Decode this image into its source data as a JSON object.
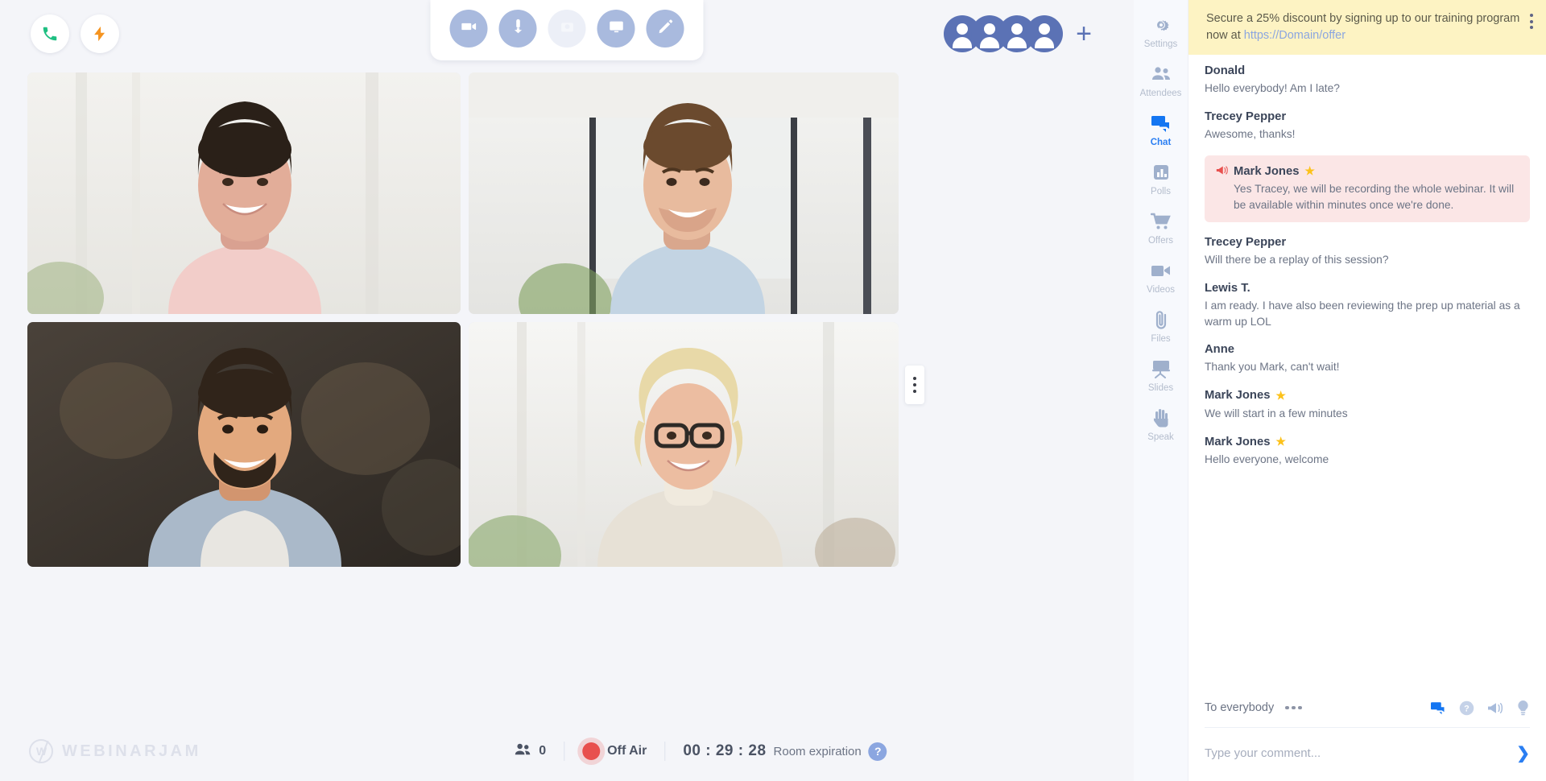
{
  "topbar": {
    "left_controls": [
      {
        "name": "phone-button",
        "icon": "phone-icon",
        "color": "#1fbf82"
      },
      {
        "name": "boost-button",
        "icon": "lightning-bolt-icon",
        "color": "#f59421"
      }
    ],
    "tools": [
      {
        "name": "camera-toggle",
        "icon": "video-camera-icon",
        "state": "enabled"
      },
      {
        "name": "microphone-toggle",
        "icon": "microphone-icon",
        "state": "enabled"
      },
      {
        "name": "presenter-toggle",
        "icon": "presenter-icon",
        "state": "disabled"
      },
      {
        "name": "screen-share-toggle",
        "icon": "monitor-icon",
        "state": "enabled"
      },
      {
        "name": "whiteboard-toggle",
        "icon": "pencil-icon",
        "state": "enabled"
      }
    ],
    "avatar_count": 4,
    "add_presenter_label": "+"
  },
  "stage": {
    "tiles": [
      {
        "name": "video-tile-1",
        "participant": "presenter-1"
      },
      {
        "name": "video-tile-2",
        "participant": "presenter-2"
      },
      {
        "name": "video-tile-3",
        "participant": "presenter-3"
      },
      {
        "name": "video-tile-4",
        "participant": "presenter-4"
      }
    ]
  },
  "bottombar": {
    "brand": "WEBINARJAM",
    "brand_mark": "W",
    "attendee_count": "0",
    "air_status": "Off Air",
    "timer": "00 : 29 : 28",
    "expiration_label": "Room expiration",
    "help_glyph": "?"
  },
  "nav": {
    "items": [
      {
        "label": "Settings",
        "icon": "gear-icon",
        "active": false
      },
      {
        "label": "Attendees",
        "icon": "people-icon",
        "active": false
      },
      {
        "label": "Chat",
        "icon": "chat-icon",
        "active": true
      },
      {
        "label": "Polls",
        "icon": "bar-chart-icon",
        "active": false
      },
      {
        "label": "Offers",
        "icon": "cart-icon",
        "active": false
      },
      {
        "label": "Videos",
        "icon": "video-icon",
        "active": false
      },
      {
        "label": "Files",
        "icon": "paperclip-icon",
        "active": false
      },
      {
        "label": "Slides",
        "icon": "easel-icon",
        "active": false
      },
      {
        "label": "Speak",
        "icon": "hand-icon",
        "active": false
      }
    ]
  },
  "promo": {
    "text_before": "Secure a 25% discount by signing up to our training program now at ",
    "link": "https://Domain/offer",
    "background": "#fdf3c3"
  },
  "chat": {
    "messages": [
      {
        "name": "Donald",
        "text": "Hello everybody! Am I late?",
        "starred": false,
        "highlight": false
      },
      {
        "name": "Trecey Pepper",
        "text": "Awesome, thanks!",
        "starred": false,
        "highlight": false
      },
      {
        "name": "Mark Jones",
        "text": "Yes Tracey, we will be recording the whole webinar. It will be available within minutes once we're done.",
        "starred": true,
        "highlight": true
      },
      {
        "name": "Trecey Pepper",
        "text": "Will there be a replay of this session?",
        "starred": false,
        "highlight": false
      },
      {
        "name": "Lewis T.",
        "text": "I am ready. I have also been reviewing the prep up material as a warm up LOL",
        "starred": false,
        "highlight": false
      },
      {
        "name": "Anne",
        "text": "Thank you Mark, can't wait!",
        "starred": false,
        "highlight": false
      },
      {
        "name": "Mark Jones",
        "text": "We will start in a few minutes",
        "starred": true,
        "highlight": false
      },
      {
        "name": "Mark Jones",
        "text": "Hello everyone, welcome",
        "starred": true,
        "highlight": false
      }
    ],
    "recipient": "To everybody",
    "composer_icons": [
      {
        "name": "chat-icon",
        "glyph": "chat"
      },
      {
        "name": "help-icon",
        "glyph": "question"
      },
      {
        "name": "announce-icon",
        "glyph": "megaphone"
      },
      {
        "name": "idea-icon",
        "glyph": "lightbulb"
      }
    ],
    "input_placeholder": "Type your comment...",
    "send_label": "❯"
  },
  "colors": {
    "accent": "#2a7ef2",
    "promo_bg": "#fdf3c3",
    "highlight_bg": "#fbe6e6",
    "offair": "#e8504e",
    "avatar": "#5b72b5"
  }
}
